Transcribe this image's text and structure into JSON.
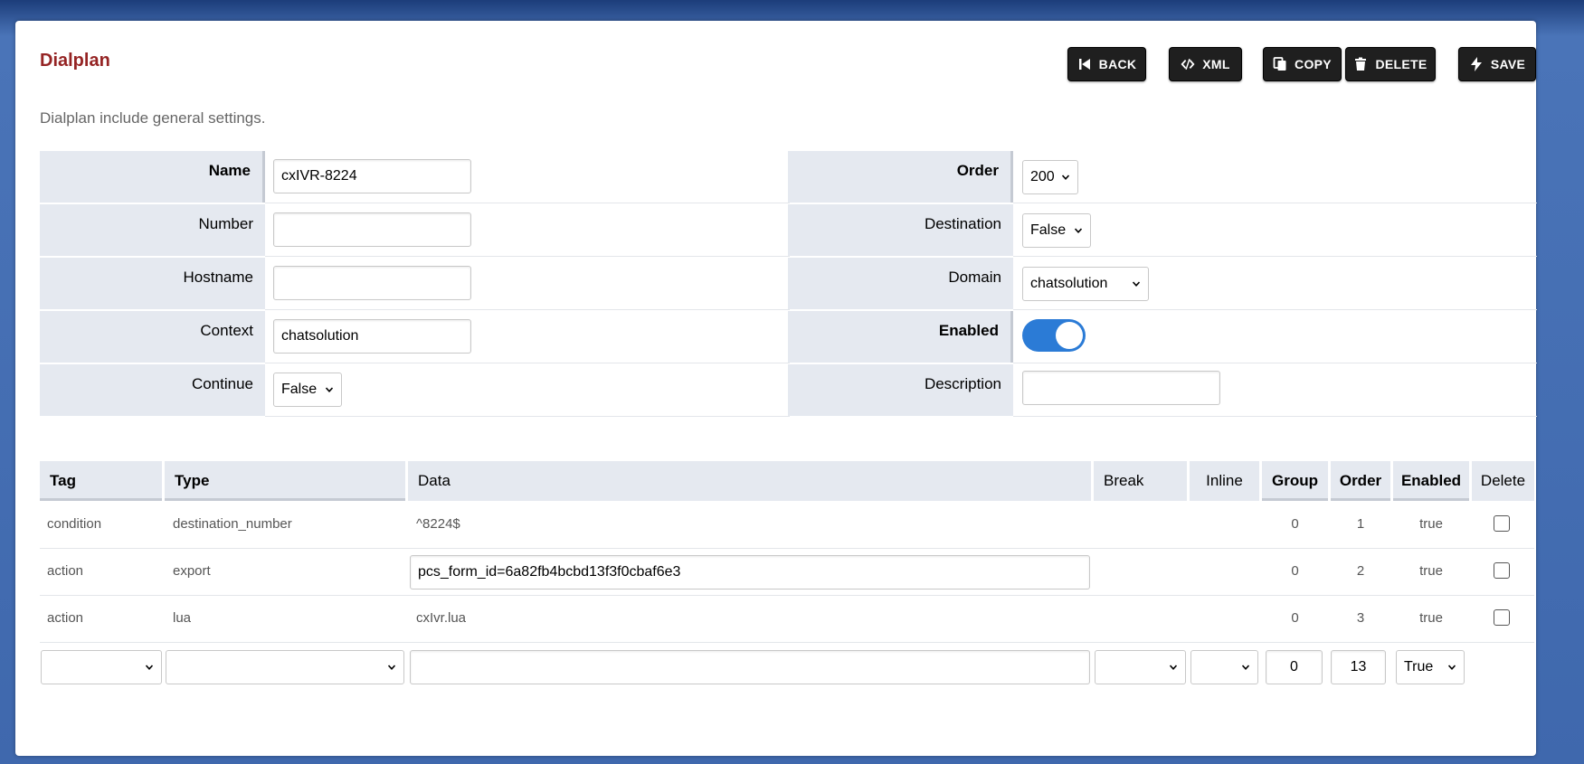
{
  "header": {
    "title": "Dialplan",
    "subtitle": "Dialplan include general settings."
  },
  "toolbar": {
    "back_label": "BACK",
    "xml_label": "XML",
    "copy_label": "COPY",
    "delete_label": "DELETE",
    "save_label": "SAVE"
  },
  "form": {
    "name": {
      "label": "Name",
      "value": "cxIVR-8224"
    },
    "number": {
      "label": "Number",
      "value": ""
    },
    "hostname": {
      "label": "Hostname",
      "value": ""
    },
    "context": {
      "label": "Context",
      "value": "chatsolution"
    },
    "continue": {
      "label": "Continue",
      "value": "False"
    },
    "order": {
      "label": "Order",
      "value": "200"
    },
    "destination": {
      "label": "Destination",
      "value": "False"
    },
    "domain": {
      "label": "Domain",
      "value": "chatsolution"
    },
    "enabled": {
      "label": "Enabled",
      "value": true
    },
    "description": {
      "label": "Description",
      "value": ""
    }
  },
  "table": {
    "headers": {
      "tag": "Tag",
      "type": "Type",
      "data": "Data",
      "break": "Break",
      "inline": "Inline",
      "group": "Group",
      "order": "Order",
      "enabled": "Enabled",
      "delete": "Delete"
    },
    "rows": [
      {
        "tag": "condition",
        "type": "destination_number",
        "data": "^8224$",
        "group": "0",
        "order": "1",
        "enabled": "true"
      },
      {
        "tag": "action",
        "type": "export",
        "data": "pcs_form_id=6a82fb4bcbd13f3f0cbaf6e3",
        "group": "0",
        "order": "2",
        "enabled": "true"
      },
      {
        "tag": "action",
        "type": "lua",
        "data": "cxIvr.lua",
        "group": "0",
        "order": "3",
        "enabled": "true"
      }
    ],
    "new_row": {
      "tag": "",
      "type": "",
      "data": "",
      "break": "",
      "inline": "",
      "group": "0",
      "order": "13",
      "enabled": "True"
    }
  },
  "colors": {
    "title": "#952424",
    "button_bg": "#1f1f1f",
    "label_bg": "#e5e9f0",
    "toggle_on": "#2b7bd6"
  },
  "icons": {
    "back": "skip-back-icon",
    "xml": "code-icon",
    "copy": "copy-icon",
    "delete": "trash-icon",
    "save": "bolt-icon"
  }
}
